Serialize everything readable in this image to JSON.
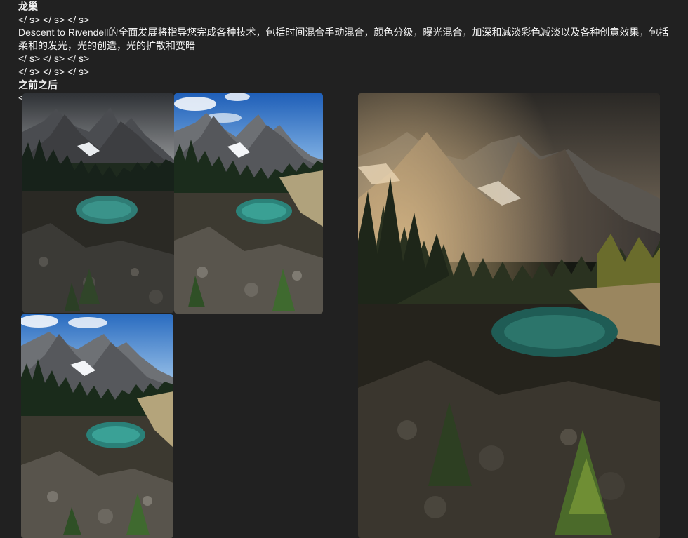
{
  "post": {
    "title": "龙巢",
    "tag_line_1": "</ s> </ s> </ s>",
    "description": "Descent to Rivendell的全面发展将指导您完成各种技术，包括时间混合手动混合，颜色分级，曝光混合，加深和减淡彩色减淡以及各种创意效果，包括柔和的发光，光的创造，光的扩散和变暗",
    "tag_line_2": "</ s> </ s> </ s>",
    "tag_line_3": "</ s> </ s> </ s>",
    "before_after_label": "之前之后",
    "stub_char": "<"
  },
  "photos": {
    "a": {
      "mood": "overcast-dark",
      "sky_top": "#3c3f44",
      "sky_bottom": "#8c8f92"
    },
    "b": {
      "mood": "blue-sky",
      "sky_top": "#2d6fc4",
      "sky_bottom": "#8cbbe9"
    },
    "c": {
      "mood": "blue-sky",
      "sky_top": "#3777c6",
      "sky_bottom": "#a3c8ec"
    },
    "d": {
      "mood": "golden-edited",
      "sky_top": "#2a2825",
      "sky_bottom": "#8a7a62"
    }
  }
}
